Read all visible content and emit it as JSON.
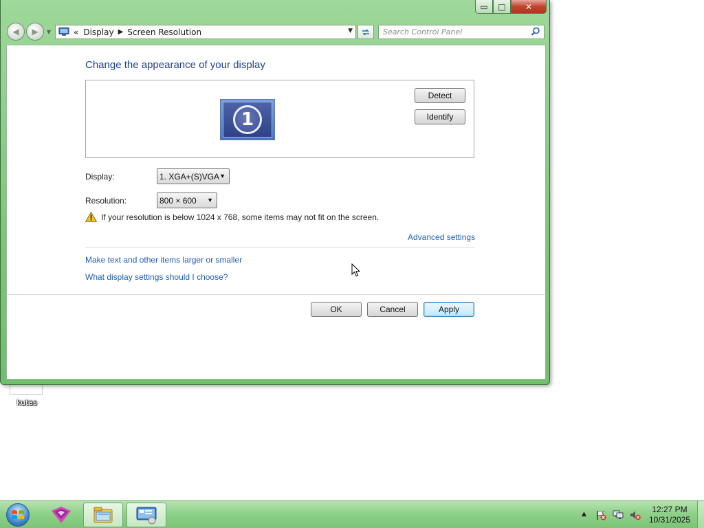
{
  "desktop": {
    "icon_label": "kutas"
  },
  "window": {
    "controls": {
      "minimize": "▭",
      "maximize": "□",
      "close": "✕"
    },
    "nav": {
      "back_icon": "back-arrow-icon",
      "forward_icon": "forward-arrow-icon"
    },
    "address": {
      "overflow": "«",
      "crumb1": "Display",
      "crumb2": "Screen Resolution"
    },
    "search": {
      "placeholder": "Search Control Panel"
    },
    "title": "Change the appearance of your display",
    "monitor_number": "1",
    "buttons": {
      "detect": "Detect",
      "identify": "Identify",
      "ok": "OK",
      "cancel": "Cancel",
      "apply": "Apply"
    },
    "display": {
      "label": "Display:",
      "value": "1. XGA+(S)VGA"
    },
    "resolution": {
      "label": "Resolution:",
      "value": "800 × 600"
    },
    "warning": "If your resolution is below 1024 x 768, some items may not fit on the screen.",
    "links": {
      "advanced": "Advanced settings",
      "text_size": "Make text and other items larger or smaller",
      "help": "What display settings should I choose?"
    }
  },
  "taskbar": {
    "clock_time": "12:27 PM",
    "clock_date": "10/31/2025"
  },
  "colors": {
    "link": "#1f5fb5",
    "title": "#1e3f8f",
    "chrome": "#8fd18a"
  }
}
